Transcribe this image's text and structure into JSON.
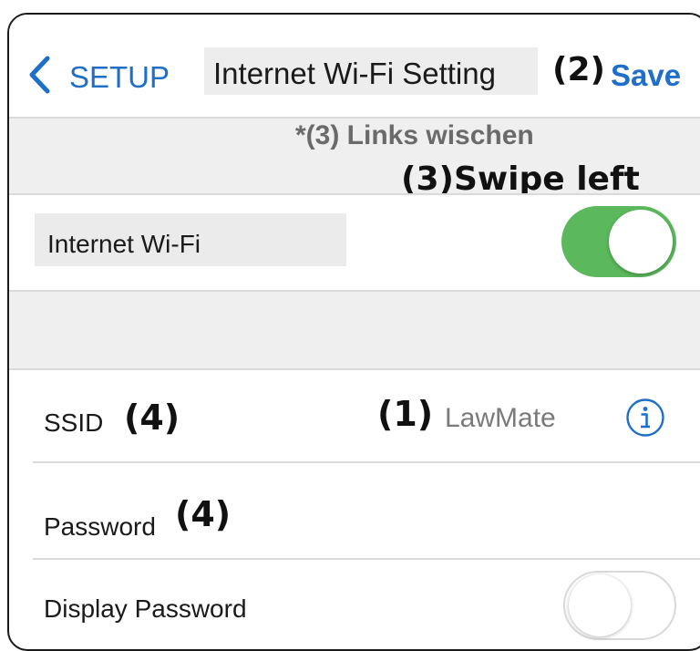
{
  "nav": {
    "back_label": "SETUP",
    "title": "Internet Wi-Fi Setting",
    "save_label": "Save",
    "back_icon": "chevron-left-icon"
  },
  "annotations": {
    "a1": "(1)",
    "a2": "(2)",
    "a3": "(3)Swipe left",
    "a4_ssid": "(4)",
    "a4_password": "(4)"
  },
  "banner": {
    "links_text": "*(3) Links wischen"
  },
  "rows": {
    "internet_wifi": {
      "label": "Internet Wi-Fi",
      "enabled": true
    },
    "ssid": {
      "label": "SSID",
      "value": "LawMate",
      "info_icon": "info-icon"
    },
    "password": {
      "label": "Password"
    },
    "display_password": {
      "label": "Display Password",
      "enabled": false
    }
  },
  "colors": {
    "accent": "#1f6fc8",
    "toggle_on": "#5cb85c",
    "section_bg": "#efefef",
    "secondary_text": "#7a7a7a"
  }
}
